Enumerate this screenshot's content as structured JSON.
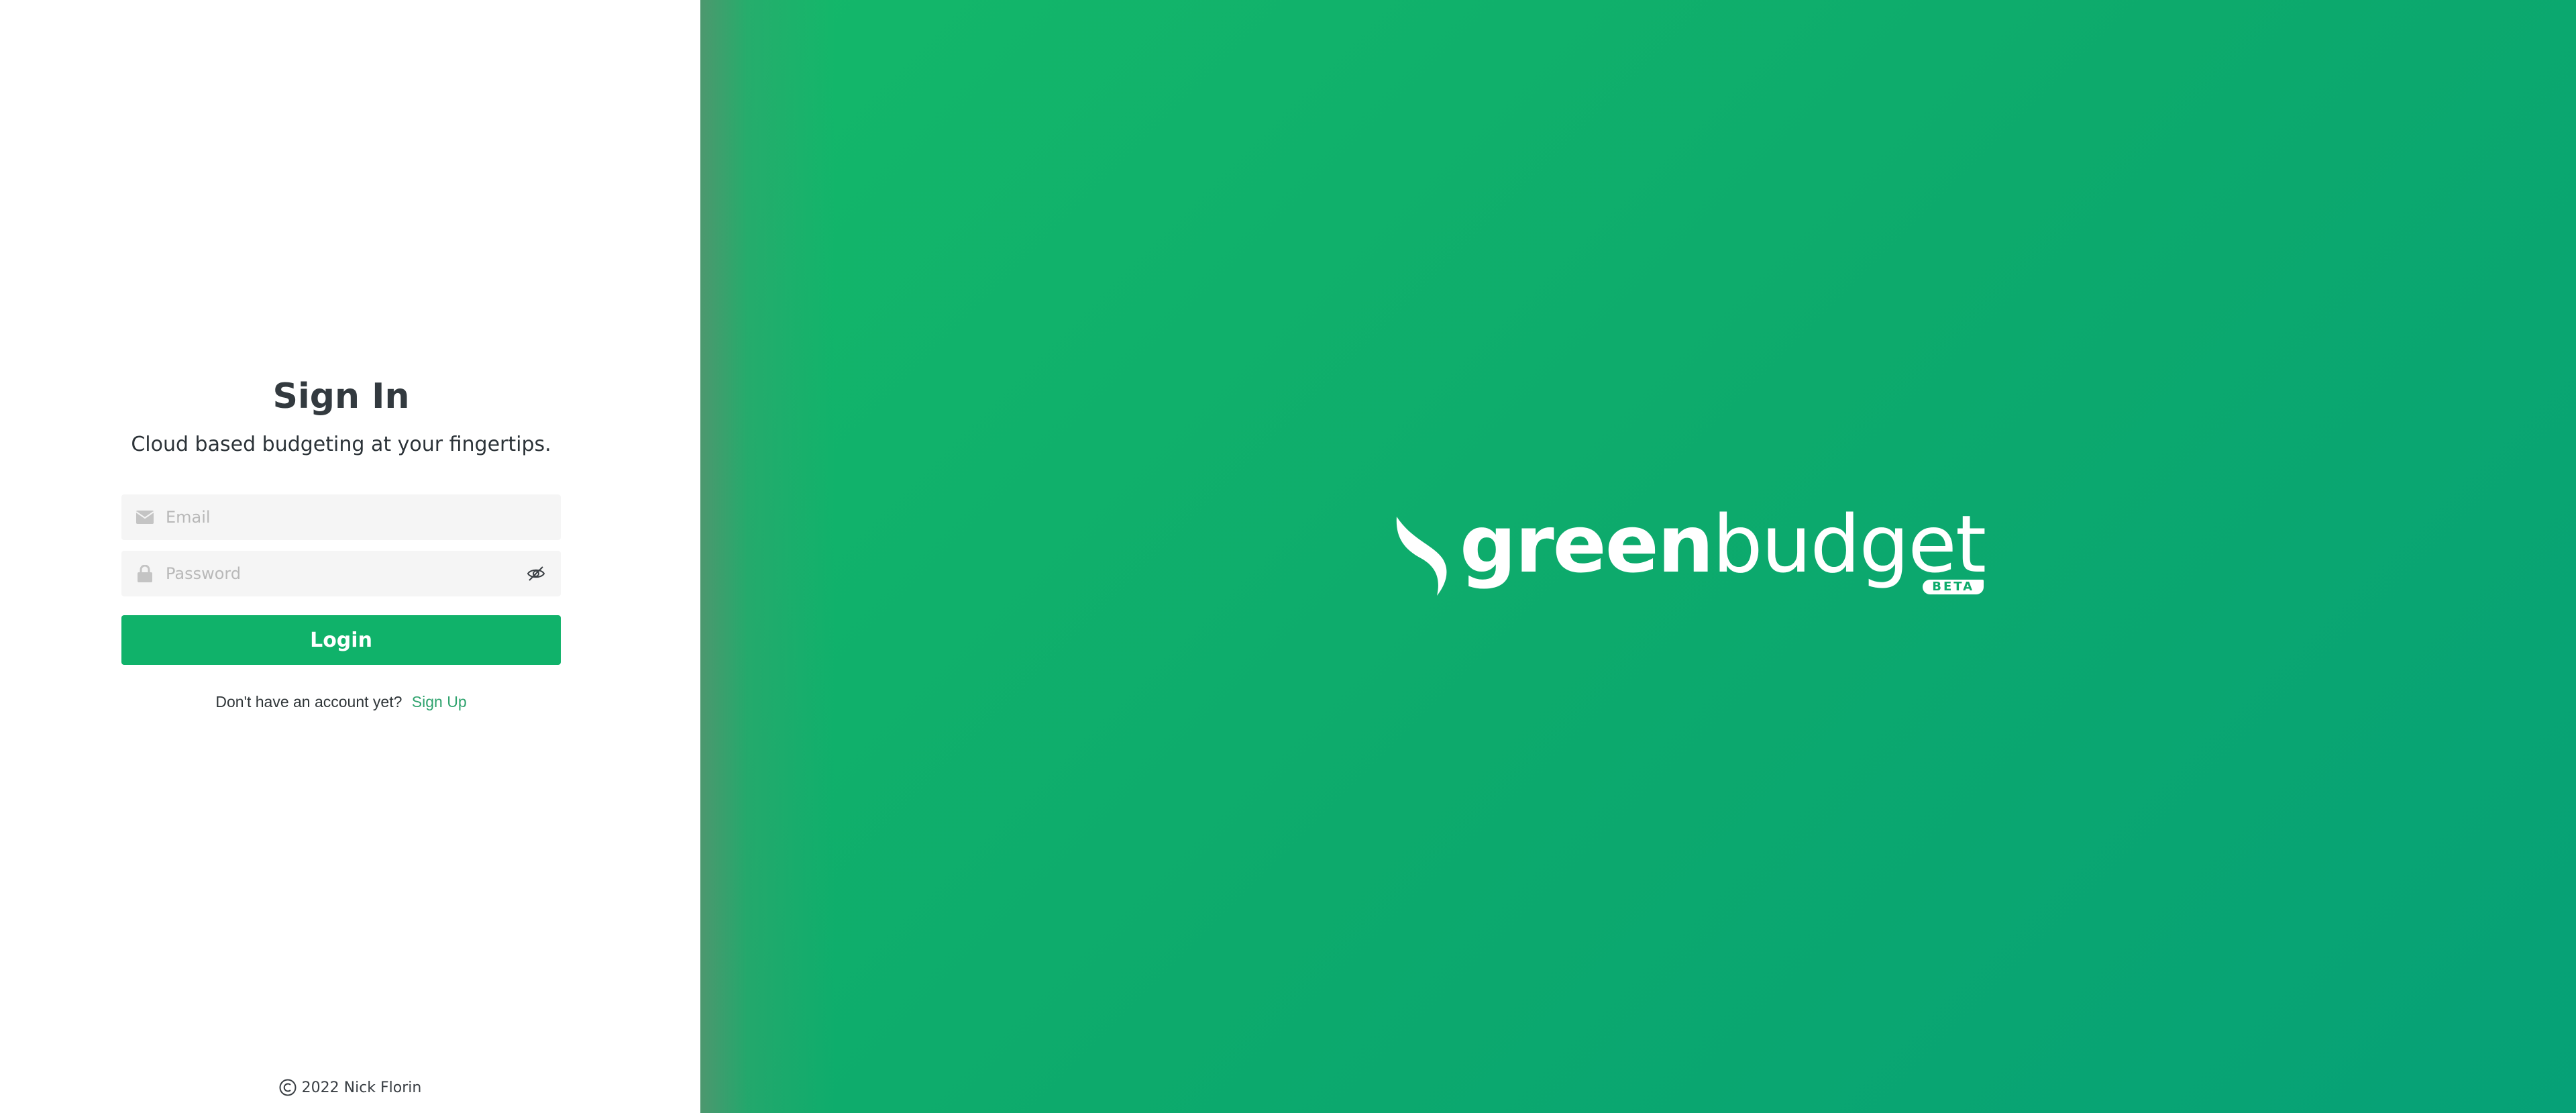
{
  "signin": {
    "title": "Sign In",
    "subtitle": "Cloud based budgeting at your fingertips.",
    "email_placeholder": "Email",
    "password_placeholder": "Password",
    "login_label": "Login",
    "no_account_text": "Don't have an account yet?",
    "signup_label": "Sign Up"
  },
  "footer": {
    "copyright": "2022 Nick Florin"
  },
  "brand": {
    "name_part1": "green",
    "name_part2": "budget",
    "badge": "BETA",
    "icon": "leaf-swoosh-icon"
  },
  "colors": {
    "accent": "#10b26a",
    "link": "#2fa36e",
    "panel_gradient_start": "#14b86a",
    "panel_gradient_end": "#06a177"
  }
}
